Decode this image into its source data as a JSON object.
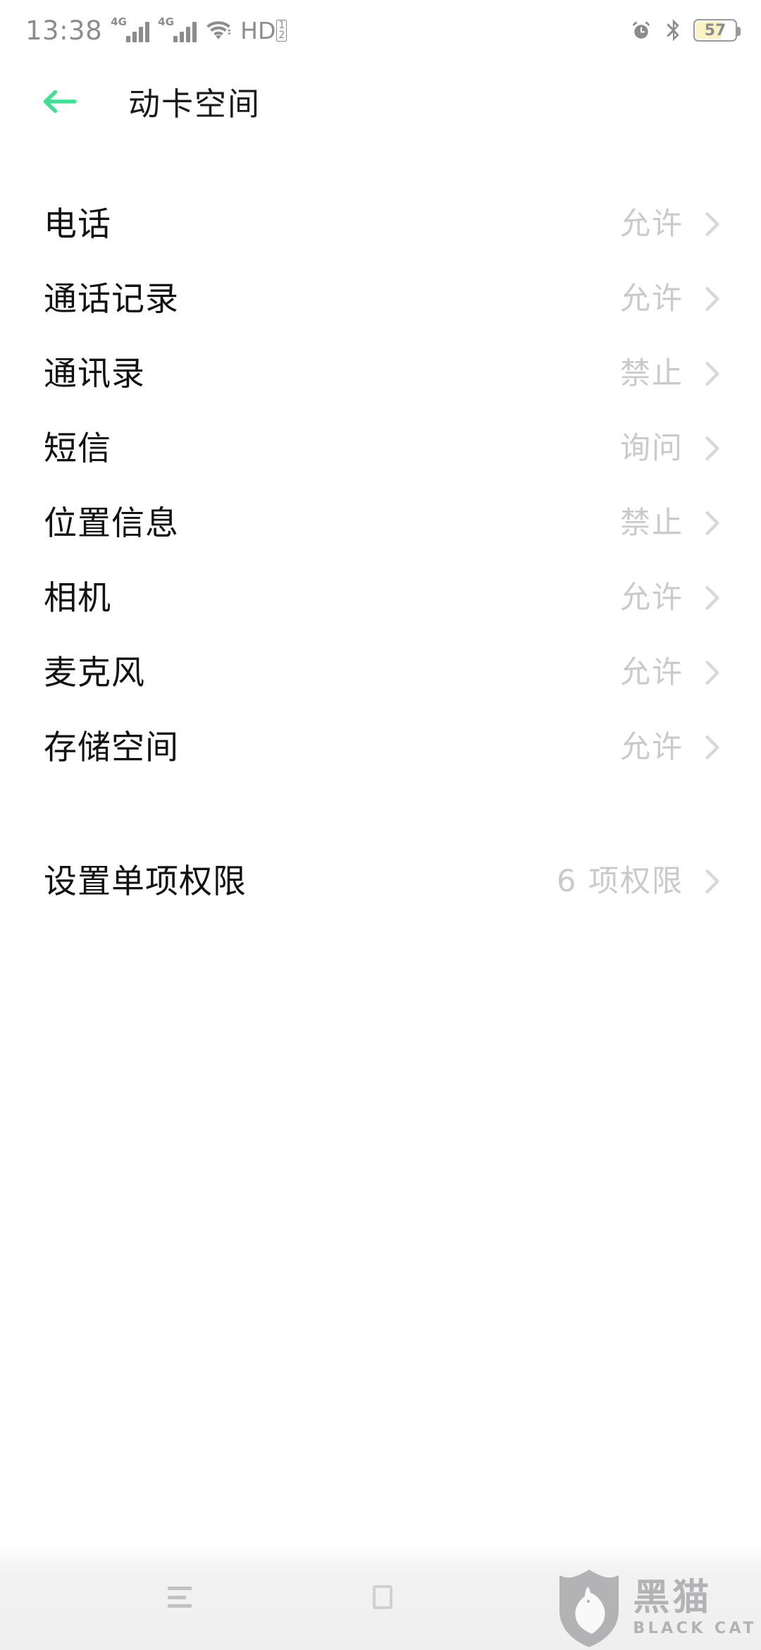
{
  "status_bar": {
    "time": "13:38",
    "network_badge_1": "4G",
    "network_badge_2": "4G",
    "wifi_icon": "wifi-icon",
    "hd_label": "HD",
    "hd_sub_top": "1",
    "hd_sub_bottom": "2",
    "alarm_icon": "alarm-clock-icon",
    "bluetooth_icon": "bluetooth-icon",
    "battery_level": "57",
    "battery_fill_color": "#fbf3c4",
    "icon_color": "#8c8c8c"
  },
  "app_bar": {
    "back_icon": "back-arrow-icon",
    "back_icon_color": "#43dd96",
    "title": "动卡空间"
  },
  "permissions": {
    "items": [
      {
        "label": "电话",
        "value": "允许"
      },
      {
        "label": "通话记录",
        "value": "允许"
      },
      {
        "label": "通讯录",
        "value": "禁止"
      },
      {
        "label": "短信",
        "value": "询问"
      },
      {
        "label": "位置信息",
        "value": "禁止"
      },
      {
        "label": "相机",
        "value": "允许"
      },
      {
        "label": "麦克风",
        "value": "允许"
      },
      {
        "label": "存储空间",
        "value": "允许"
      }
    ],
    "extra": {
      "label": "设置单项权限",
      "value": "6 项权限"
    },
    "label_color": "#121212",
    "value_color": "#cacaca"
  },
  "nav_bar": {
    "recents_icon": "recents-icon",
    "home_icon": "home-icon",
    "back_icon": "nav-back-icon"
  },
  "watermark": {
    "shield_icon": "black-cat-shield-logo",
    "name_cn": "黑猫",
    "name_en": "BLACK CAT",
    "color": "#8e8e93"
  }
}
